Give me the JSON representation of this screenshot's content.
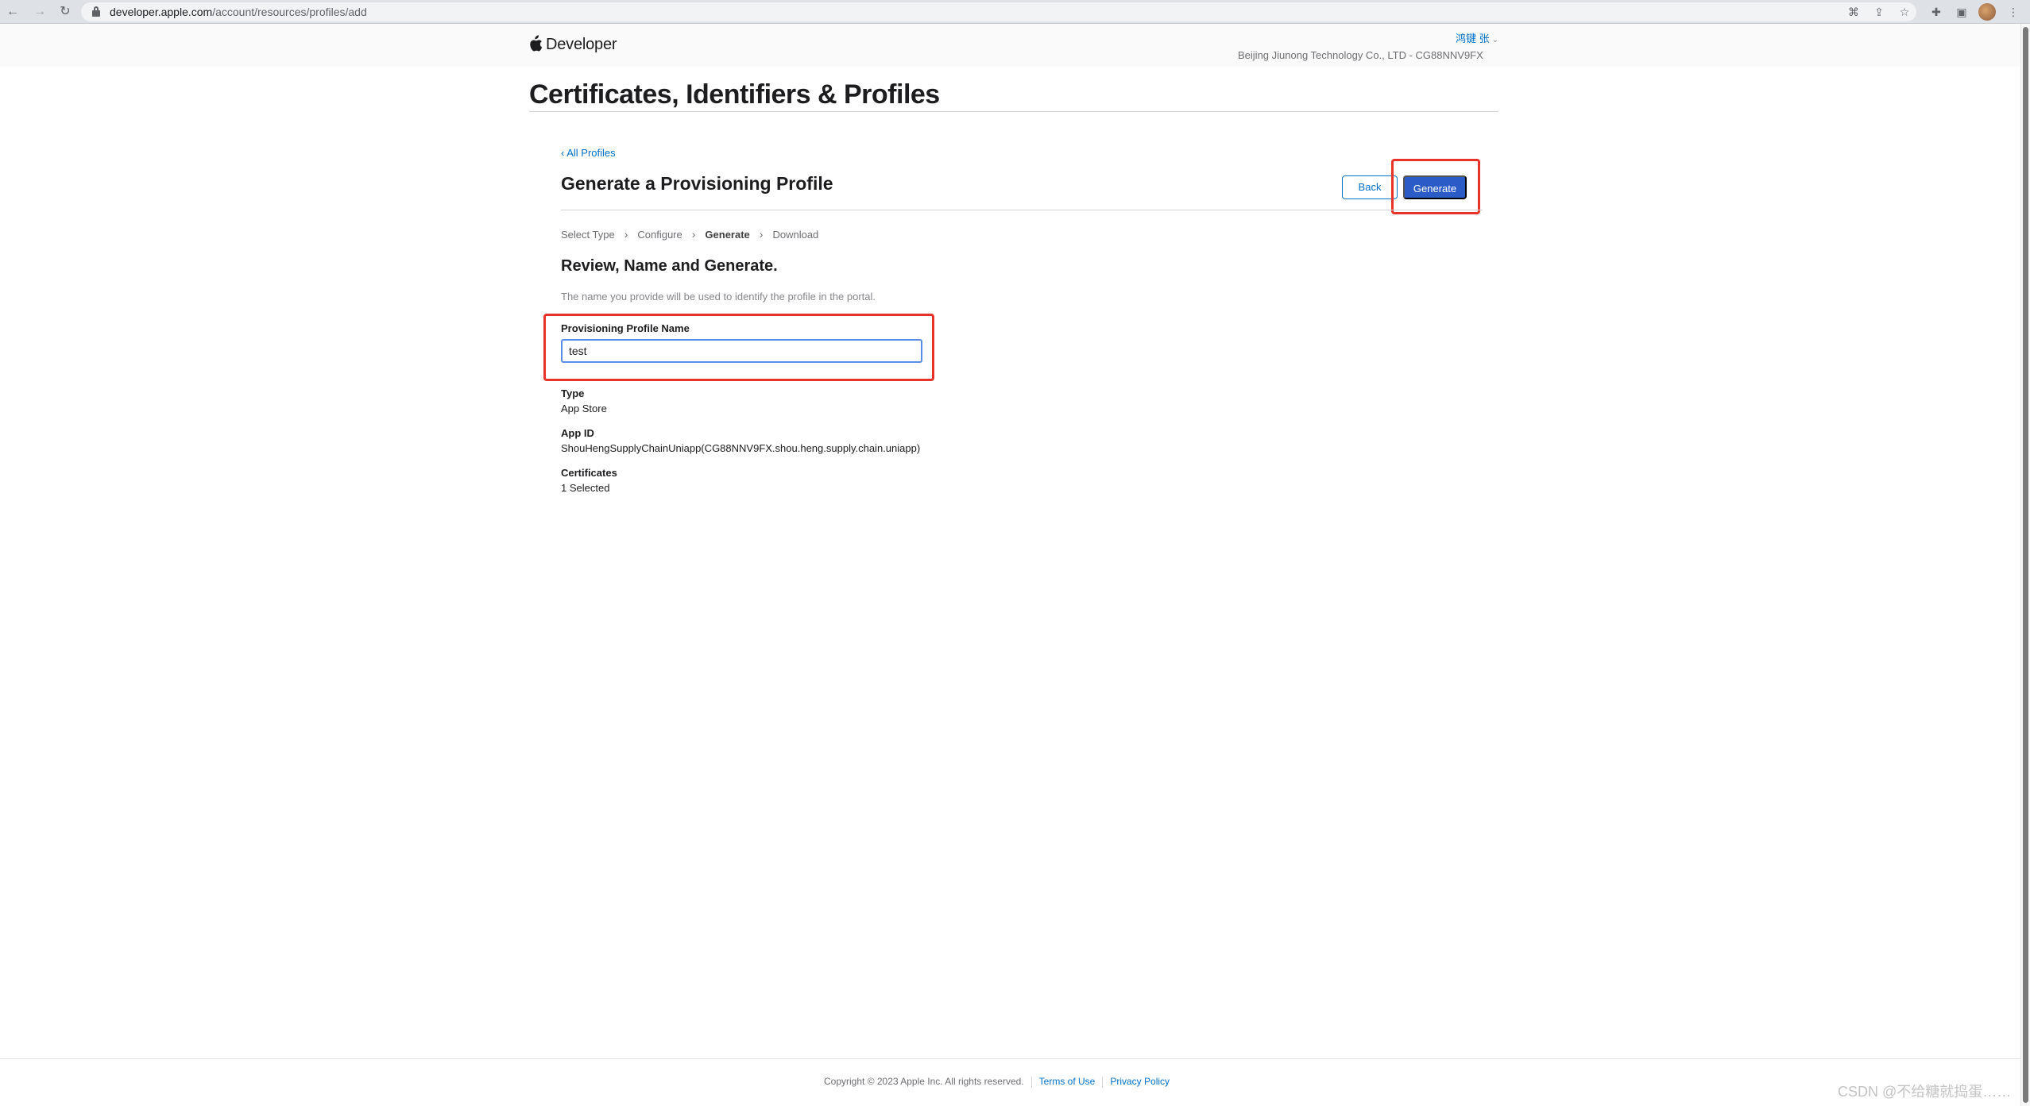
{
  "browser": {
    "url_host": "developer.apple.com",
    "url_path": "/account/resources/profiles/add",
    "icons": [
      "back-arrow-icon",
      "forward-arrow-icon",
      "reload-icon",
      "translate-icon",
      "share-icon",
      "bookmark-star-icon",
      "extensions-puzzle-icon",
      "side-panel-icon",
      "profile-avatar",
      "menu-kebab-icon"
    ]
  },
  "header": {
    "brand": "Developer",
    "user": "鸿键 张",
    "team": "Beijing Jiunong Technology Co., LTD - CG88NNV9FX"
  },
  "page": {
    "title": "Certificates, Identifiers & Profiles",
    "back_link": "‹ All Profiles",
    "section_title": "Generate a Provisioning Profile",
    "back_button": "Back",
    "generate_button": "Generate"
  },
  "steps": [
    "Select Type",
    "Configure",
    "Generate",
    "Download"
  ],
  "current_step": "Generate",
  "review": {
    "title": "Review, Name and Generate.",
    "hint": "The name you provide will be used to identify the profile in the portal.",
    "name_label": "Provisioning Profile Name",
    "name_value": "test"
  },
  "details": [
    {
      "label": "Type",
      "value": "App Store"
    },
    {
      "label": "App ID",
      "value": "ShouHengSupplyChainUniapp(CG88NNV9FX.shou.heng.supply.chain.uniapp)"
    },
    {
      "label": "Certificates",
      "value": "1 Selected"
    }
  ],
  "footer": {
    "copyright": "Copyright © 2023 Apple Inc. All rights reserved.",
    "terms": "Terms of Use",
    "privacy": "Privacy Policy"
  },
  "watermark": "CSDN @不给糖就捣蛋……",
  "colors": {
    "link": "#0070c9",
    "primary_button": "#2a5bc7",
    "highlight": "#e8332a"
  }
}
